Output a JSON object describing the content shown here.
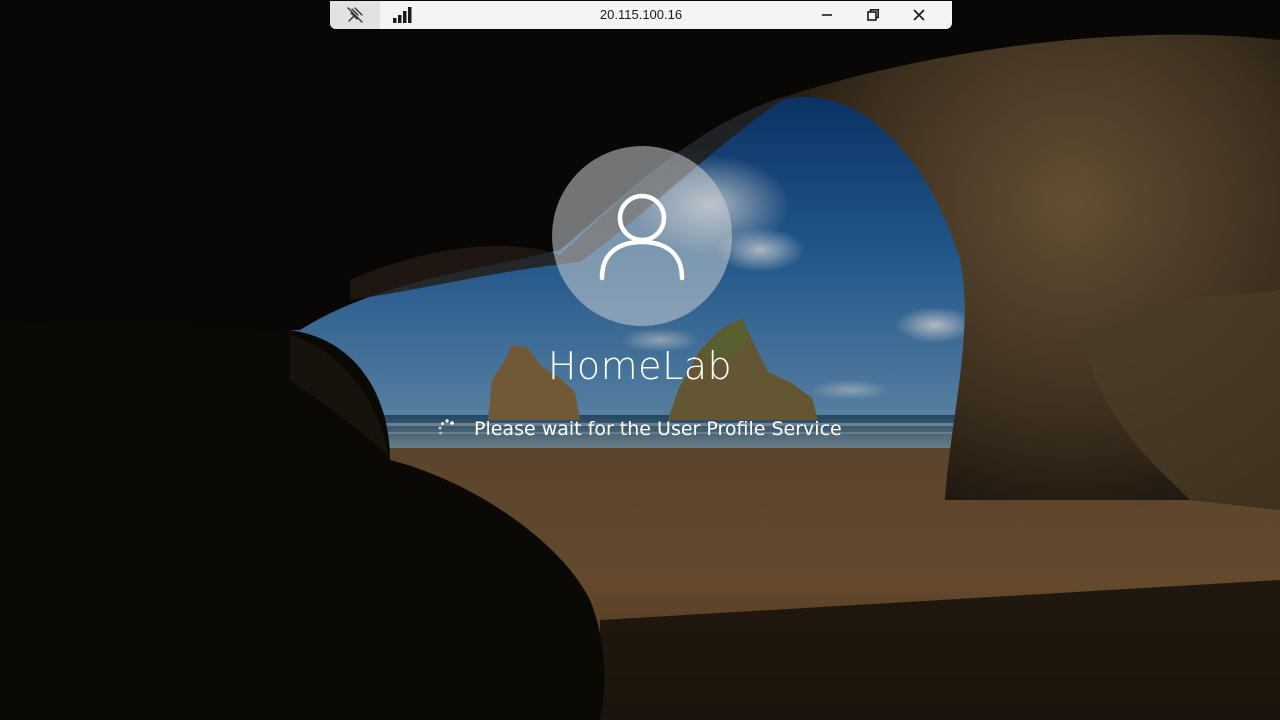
{
  "connection_bar": {
    "host": "20.115.100.16",
    "pin_icon": "unpin-icon",
    "signal_icon": "signal-strength-icon",
    "minimize_icon": "minimize-icon",
    "restore_icon": "restore-icon",
    "close_icon": "close-icon"
  },
  "lock_screen": {
    "avatar_icon": "user-icon",
    "username": "HomeLab",
    "status_message": "Please wait for the User Profile Service",
    "spinner_icon": "loading-spinner-icon"
  },
  "colors": {
    "bar_background": "#f4f4f4",
    "text": "#ffffff",
    "avatar_background": "#c8cdd2"
  }
}
